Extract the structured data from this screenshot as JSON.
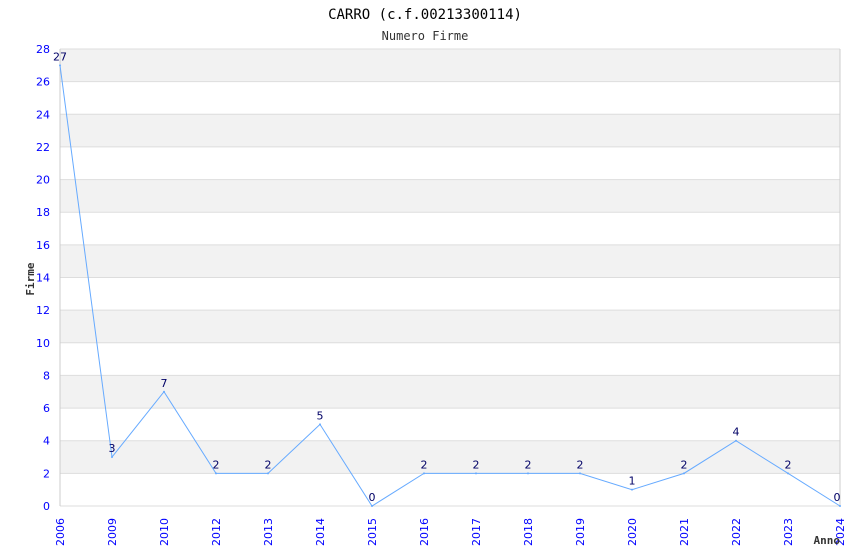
{
  "chart_data": {
    "type": "line",
    "title": "CARRO (c.f.00213300114)",
    "subtitle": "Numero Firme",
    "xlabel": "Anno",
    "ylabel": "Firme",
    "categories": [
      "2006",
      "2009",
      "2010",
      "2012",
      "2013",
      "2014",
      "2015",
      "2016",
      "2017",
      "2018",
      "2019",
      "2020",
      "2021",
      "2022",
      "2023",
      "2024"
    ],
    "values": [
      27,
      3,
      7,
      2,
      2,
      5,
      0,
      2,
      2,
      2,
      2,
      1,
      2,
      4,
      2,
      0
    ],
    "ylim": [
      0,
      28
    ],
    "yticks": [
      0,
      2,
      4,
      6,
      8,
      10,
      12,
      14,
      16,
      18,
      20,
      22,
      24,
      26,
      28
    ],
    "grid": true,
    "colors": {
      "line": "#66aaff",
      "tick_labels": "#0000ff",
      "data_labels": "#000066",
      "band": "#f2f2f2",
      "grid": "#dddddd"
    }
  }
}
